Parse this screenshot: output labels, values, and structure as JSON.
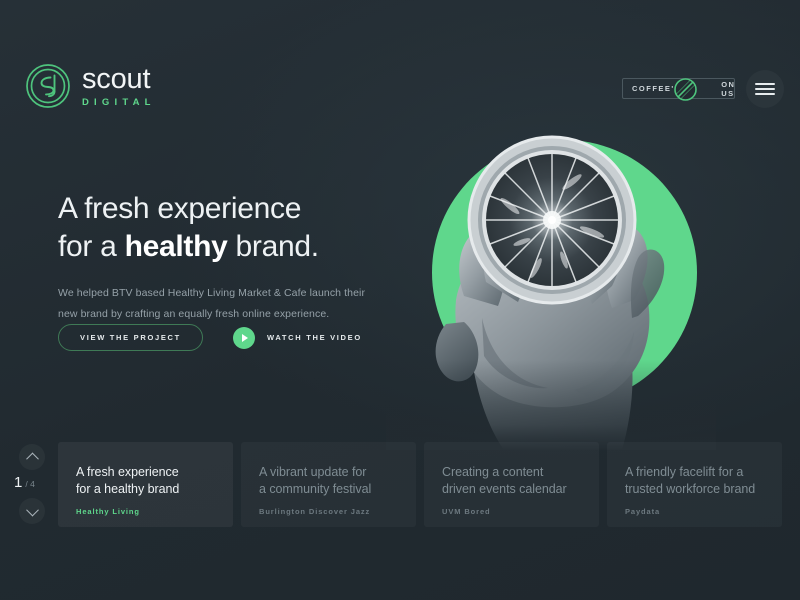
{
  "theme": {
    "background": "#222b31",
    "accent_green": "#5fd78c",
    "text_primary": "#eef2f4",
    "text_muted": "#95a1a8",
    "card_bg": "#2a343a"
  },
  "header": {
    "logo": {
      "mark_icon": "sd-monogram-circle-icon",
      "wordmark": "scout",
      "subword": "DIGITAL"
    },
    "coffee_button": {
      "label_left": "COFFEE'S",
      "label_right": "ON US",
      "icon": "coffee-bean-icon"
    },
    "menu_button": {
      "icon": "hamburger-menu-icon"
    }
  },
  "hero": {
    "heading_line1": "A fresh experience",
    "heading_line2_pre": "for a ",
    "heading_line2_strong": "healthy",
    "heading_line2_post": " brand.",
    "paragraph": "We helped BTV based Healthy Living Market & Cafe launch their\nnew brand by crafting an equally fresh online experience.",
    "primary_cta": "VIEW THE PROJECT",
    "secondary_cta": "WATCH THE VIDEO",
    "play_icon": "play-triangle-icon",
    "image_alt": "hand-holding-citrus-slice-photo"
  },
  "carousel": {
    "counter_current": "1",
    "counter_total": "/ 4",
    "nav_up_icon": "chevron-up-icon",
    "nav_down_icon": "chevron-down-icon",
    "cards": [
      {
        "title": "A fresh experience\nfor a healthy brand",
        "client": "Healthy Living",
        "active": true
      },
      {
        "title": "A vibrant update for\na community festival",
        "client": "Burlington Discover Jazz",
        "active": false
      },
      {
        "title": "Creating a content\ndriven events calendar",
        "client": "UVM Bored",
        "active": false
      },
      {
        "title": "A friendly facelift for a\ntrusted workforce brand",
        "client": "Paydata",
        "active": false
      }
    ]
  }
}
